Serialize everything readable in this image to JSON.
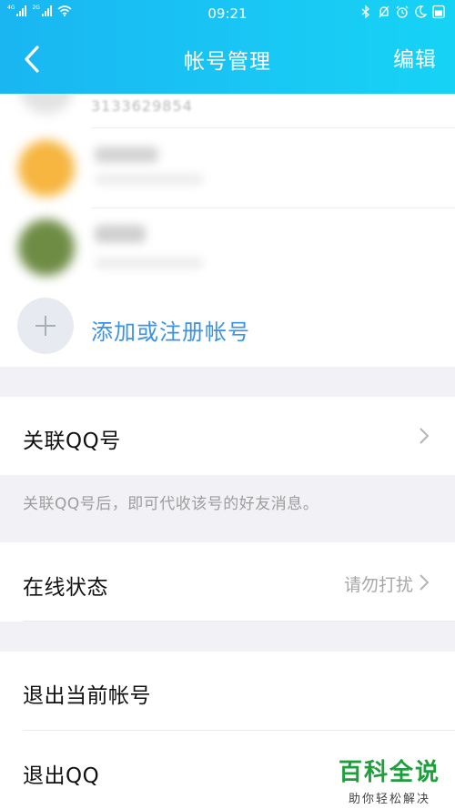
{
  "status": {
    "sim1": "4G",
    "sim2": "2G",
    "time": "09:21"
  },
  "header": {
    "title": "帐号管理",
    "edit_label": "编辑"
  },
  "accounts": {
    "first_number": "3133629854",
    "add_label": "添加或注册帐号"
  },
  "settings": {
    "linked_qq": "关联QQ号",
    "linked_qq_note": "关联QQ号后，即可代收该号的好友消息。",
    "online_status": "在线状态",
    "online_status_value": "请勿打扰",
    "logout_current": "退出当前帐号",
    "quit_qq": "退出QQ"
  },
  "watermark": {
    "brand": "百科全说",
    "slogan": "助你轻松解决"
  },
  "colors": {
    "header": "#19c0f3",
    "accent_text": "#3b93e5",
    "watermark_green": "#1e9f3c"
  }
}
